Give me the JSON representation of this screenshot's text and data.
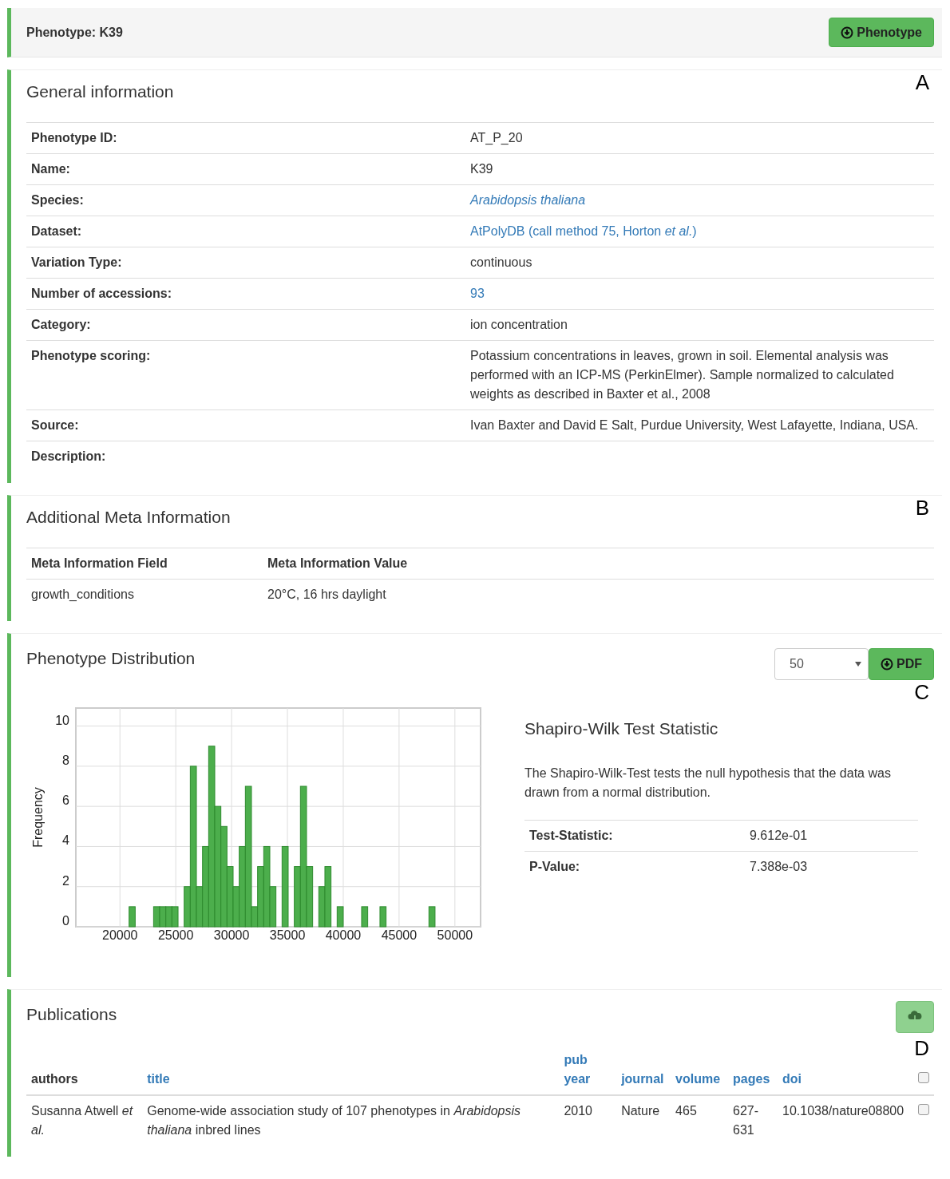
{
  "header": {
    "title": "Phenotype: K39",
    "button": "Phenotype"
  },
  "general": {
    "title": "General information",
    "panel_label": "A",
    "rows": [
      {
        "label": "Phenotype ID:",
        "value": "AT_P_20",
        "link": false,
        "italic": false
      },
      {
        "label": "Name:",
        "value": "K39",
        "link": false,
        "italic": false
      },
      {
        "label": "Species:",
        "value": "Arabidopsis thaliana",
        "link": true,
        "italic": true
      },
      {
        "label": "Dataset:",
        "value": "AtPolyDB (call method 75, Horton *et al.*)",
        "link": true,
        "italic": false
      },
      {
        "label": "Variation Type:",
        "value": "continuous",
        "link": false,
        "italic": false
      },
      {
        "label": "Number of accessions:",
        "value": "93",
        "link": true,
        "italic": false
      },
      {
        "label": "Category:",
        "value": "ion concentration",
        "link": false,
        "italic": false
      },
      {
        "label": "Phenotype scoring:",
        "value": "Potassium concentrations in leaves, grown in soil. Elemental analysis was performed with an ICP-MS (PerkinElmer). Sample normalized to calculated weights as described in Baxter et al., 2008",
        "link": false,
        "italic": false
      },
      {
        "label": "Source:",
        "value": "Ivan Baxter and David E Salt, Purdue University, West Lafayette, Indiana, USA.",
        "link": false,
        "italic": false
      },
      {
        "label": "Description:",
        "value": null
      }
    ]
  },
  "meta": {
    "title": "Additional Meta Information",
    "panel_label": "B",
    "columns": [
      "Meta Information Field",
      "Meta Information Value"
    ],
    "rows": [
      [
        "growth_conditions",
        "20°C, 16 hrs daylight"
      ]
    ]
  },
  "distribution": {
    "title": "Phenotype Distribution",
    "panel_label": "C",
    "bins_select": "50",
    "pdf_button": "PDF",
    "chart_data": {
      "type": "bar",
      "ylabel": "Frequency",
      "x": [
        21094,
        21642,
        22190,
        22738,
        23286,
        23834,
        24382,
        24930,
        25478,
        26026,
        26574,
        27122,
        27670,
        28218,
        28766,
        29314,
        29862,
        30410,
        30958,
        31506,
        32054,
        32602,
        33150,
        33698,
        34246,
        34794,
        35342,
        35890,
        36438,
        36986,
        37534,
        38082,
        38630,
        39178,
        39726,
        40274,
        40822,
        41370,
        41918,
        42466,
        43014,
        43562,
        44110,
        44658,
        45206,
        45754,
        46302,
        46850,
        47398,
        47946
      ],
      "grid": true,
      "series": [
        {
          "color": "#4cae4c",
          "values": [
            1,
            0,
            0,
            0,
            1,
            1,
            1,
            1,
            0,
            2,
            8,
            2,
            4,
            9,
            6,
            5,
            3,
            2,
            4,
            7,
            1,
            3,
            4,
            2,
            0,
            4,
            0,
            3,
            7,
            3,
            0,
            2,
            3,
            0,
            1,
            0,
            0,
            0,
            1,
            0,
            0,
            1,
            0,
            0,
            0,
            0,
            0,
            0,
            0,
            1
          ]
        }
      ],
      "xlim": [
        16050,
        52300
      ],
      "ylim": [
        0,
        10.9
      ],
      "xticks": [
        20000,
        25000,
        30000,
        35000,
        40000,
        45000,
        50000
      ],
      "yticks": [
        0,
        2,
        4,
        6,
        8,
        10
      ]
    },
    "stats": {
      "title": "Shapiro-Wilk Test Statistic",
      "text": "The Shapiro-Wilk-Test tests the null hypothesis that the data was drawn from a normal distribution.",
      "rows": [
        {
          "label": "Test-Statistic:",
          "value": "9.612e-01"
        },
        {
          "label": "P-Value:",
          "value": "7.388e-03"
        }
      ]
    }
  },
  "publications": {
    "title": "Publications",
    "panel_label": "D",
    "download_disabled": true,
    "columns": [
      {
        "label": "authors",
        "sortable": false
      },
      {
        "label": "title",
        "sortable": true
      },
      {
        "label": "pub year",
        "sortable": true
      },
      {
        "label": "journal",
        "sortable": true
      },
      {
        "label": "volume",
        "sortable": true
      },
      {
        "label": "pages",
        "sortable": true
      },
      {
        "label": "doi",
        "sortable": true
      }
    ],
    "select_all_checked": false,
    "rows": [
      {
        "cells": [
          "Susanna Atwell *et al.*",
          "Genome-wide association study of 107 phenotypes in *Arabidopsis thaliana* inbred lines",
          "2010",
          "Nature",
          "465",
          "627-631",
          "10.1038/nature08800"
        ],
        "checked": false
      }
    ]
  }
}
